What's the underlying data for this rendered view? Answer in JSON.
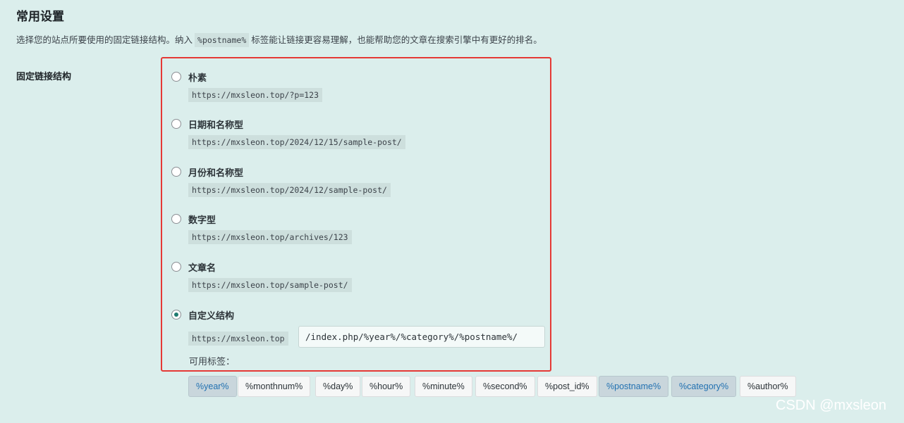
{
  "section": {
    "title": "常用设置",
    "intro_before": "选择您的站点所要使用的固定链接结构。纳入",
    "intro_code": "%postname%",
    "intro_after": "标签能让链接更容易理解，也能帮助您的文章在搜索引擎中有更好的排名。"
  },
  "permalink": {
    "label": "固定链接结构",
    "options": [
      {
        "label": "朴素",
        "url": "https://mxsleon.top/?p=123",
        "checked": false
      },
      {
        "label": "日期和名称型",
        "url": "https://mxsleon.top/2024/12/15/sample-post/",
        "checked": false
      },
      {
        "label": "月份和名称型",
        "url": "https://mxsleon.top/2024/12/sample-post/",
        "checked": false
      },
      {
        "label": "数字型",
        "url": "https://mxsleon.top/archives/123",
        "checked": false
      },
      {
        "label": "文章名",
        "url": "https://mxsleon.top/sample-post/",
        "checked": false
      },
      {
        "label": "自定义结构",
        "url": "https://mxsleon.top",
        "checked": true
      }
    ],
    "custom_value": "/index.php/%year%/%category%/%postname%/",
    "available_tags_label": "可用标签：",
    "tags": [
      {
        "label": "%year%",
        "active": true
      },
      {
        "label": "%monthnum%",
        "active": false
      },
      {
        "label": "%day%",
        "active": false
      },
      {
        "label": "%hour%",
        "active": false
      },
      {
        "label": "%minute%",
        "active": false
      },
      {
        "label": "%second%",
        "active": false
      },
      {
        "label": "%post_id%",
        "active": false
      },
      {
        "label": "%postname%",
        "active": true
      },
      {
        "label": "%category%",
        "active": true
      },
      {
        "label": "%author%",
        "active": false
      }
    ]
  },
  "watermark": "CSDN @mxsleon",
  "colors": {
    "background": "#dbeeec",
    "highlight_border": "#e53935",
    "radio_checked": "#1f7a6f",
    "tag_active_text": "#2271b1"
  }
}
